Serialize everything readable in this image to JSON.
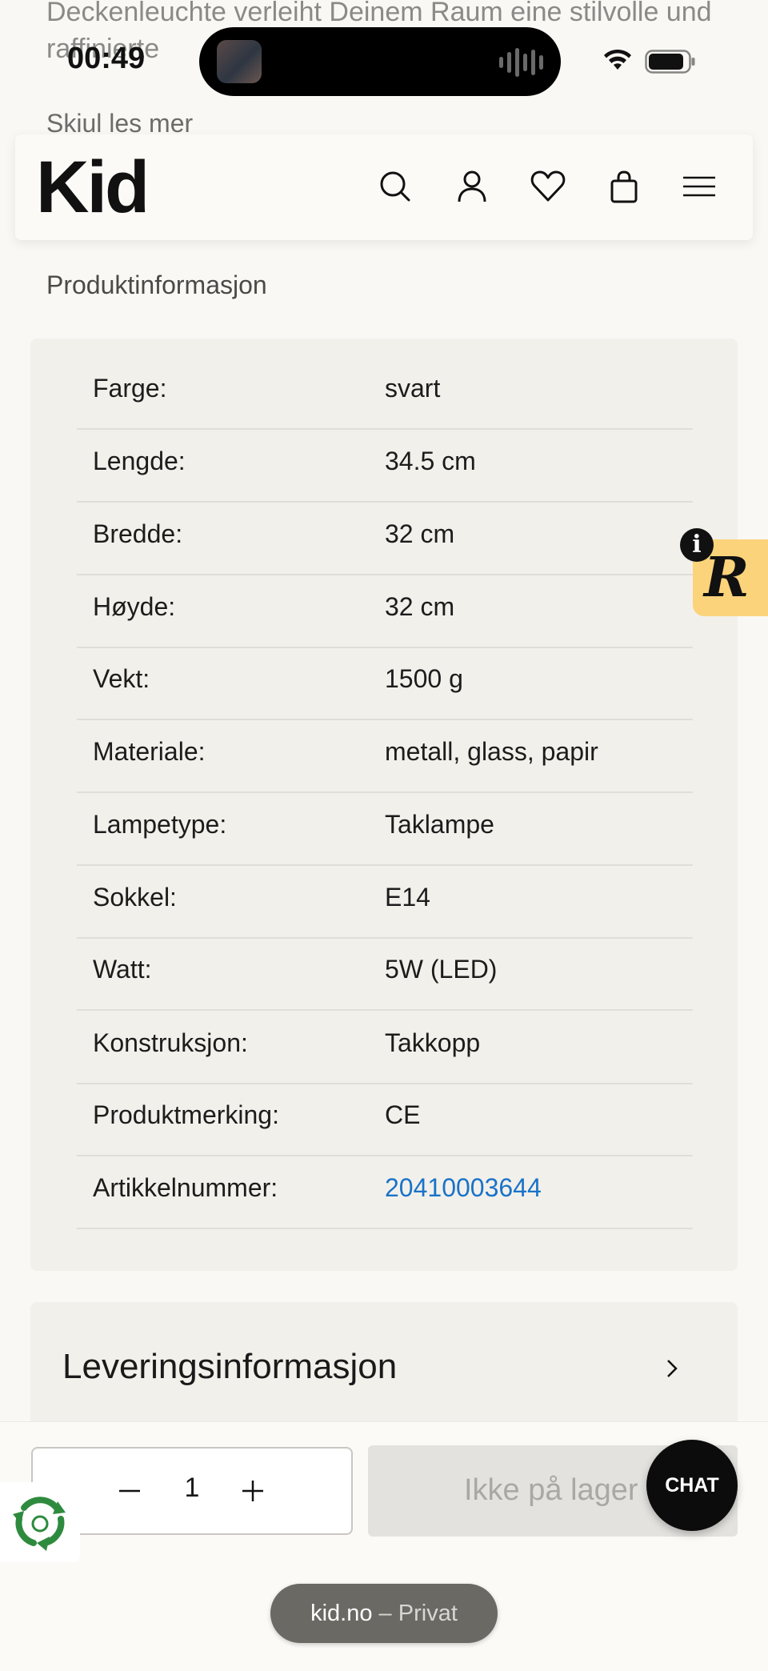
{
  "page": {
    "description_tail": "Deckenleuchte verleiht Deinem Raum eine stilvolle und raffinierte",
    "show_less": "Skiul les mer"
  },
  "status_bar": {
    "time": "00:49"
  },
  "header": {
    "logo": "Kid",
    "icons": [
      "search-icon",
      "account-icon",
      "heart-icon",
      "bag-icon",
      "menu-icon"
    ]
  },
  "product_info": {
    "title": "Produktinformasjon",
    "rows": [
      {
        "label": "Farge:",
        "value": "svart"
      },
      {
        "label": "Lengde:",
        "value": "34.5 cm"
      },
      {
        "label": "Bredde:",
        "value": "32 cm"
      },
      {
        "label": "Høyde:",
        "value": "32 cm"
      },
      {
        "label": "Vekt:",
        "value": "1500 g"
      },
      {
        "label": "Materiale:",
        "value": "metall, glass, papir"
      },
      {
        "label": "Lampetype:",
        "value": "Taklampe"
      },
      {
        "label": "Sokkel:",
        "value": "E14"
      },
      {
        "label": "Watt:",
        "value": "5W (LED)"
      },
      {
        "label": "Konstruksjon:",
        "value": "Takkopp"
      },
      {
        "label": "Produktmerking:",
        "value": "CE"
      },
      {
        "label": "Artikkelnummer:",
        "value": "20410003644"
      }
    ]
  },
  "delivery": {
    "title": "Leveringsinformasjon"
  },
  "cart": {
    "quantity": "1",
    "stock_label": "Ikke på lager",
    "chat_label": "CHAT"
  },
  "side_badge": {
    "letter": "R",
    "info": "i"
  },
  "browser": {
    "domain": "kid.no",
    "separator": " – ",
    "mode": "Privat"
  },
  "colors": {
    "link": "#1a73c8",
    "badge": "#fbd37a",
    "card": "#f2f0eb"
  }
}
